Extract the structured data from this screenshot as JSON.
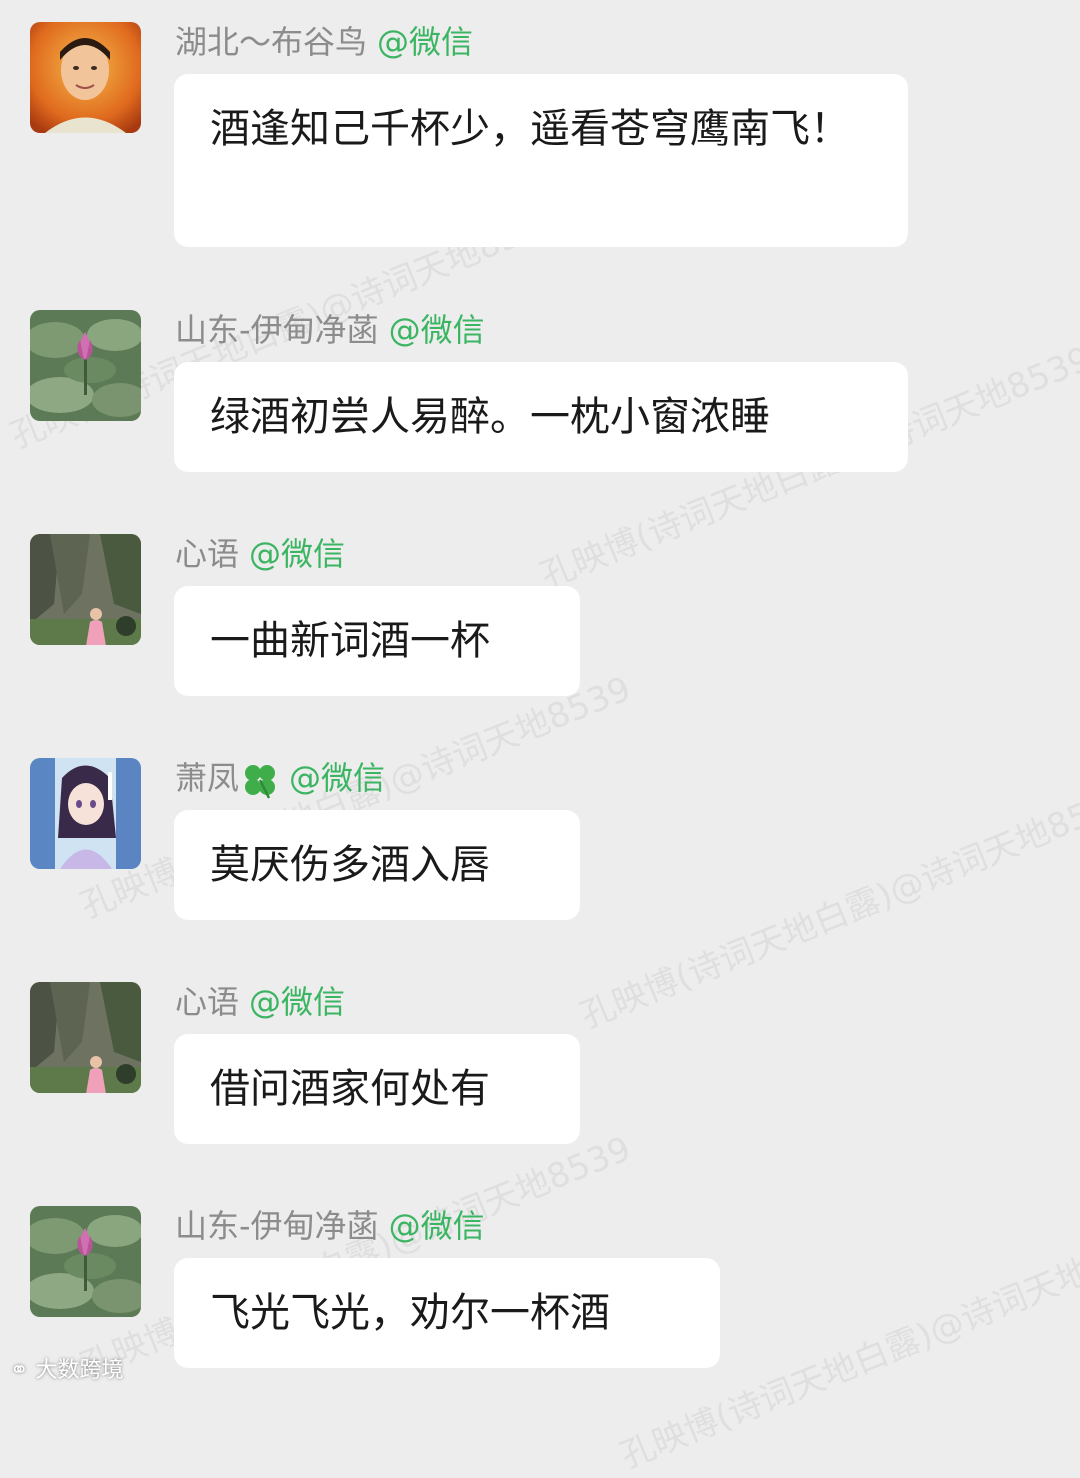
{
  "chat": {
    "messages": [
      {
        "sender": "湖北～布谷鸟",
        "tag": "@微信",
        "avatar": "man-portrait-avatar",
        "text": "酒逢知己千杯少，遥看苍穹鹰南飞！"
      },
      {
        "sender": "山东-伊甸净菡",
        "tag": "@微信",
        "avatar": "lotus-avatar",
        "text": "绿酒初尝人易醉。一枕小窗浓睡"
      },
      {
        "sender": "心语",
        "tag": "@微信",
        "avatar": "rock-landscape-avatar",
        "text": "一曲新词酒一杯"
      },
      {
        "sender": "萧凤",
        "emoji": "four-leaf-clover",
        "tag": "@微信",
        "avatar": "anime-girl-avatar",
        "text": "莫厌伤多酒入唇"
      },
      {
        "sender": "心语",
        "tag": "@微信",
        "avatar": "rock-landscape-avatar",
        "text": "借问酒家何处有"
      },
      {
        "sender": "山东-伊甸净菡",
        "tag": "@微信",
        "avatar": "lotus-avatar",
        "text": "飞光飞光，劝尔一杯酒"
      }
    ]
  },
  "watermark": {
    "line1": "孔映博(诗词天地白露)@诗词天地8539"
  },
  "footer": {
    "logo_text": "大数跨境"
  },
  "colors": {
    "background": "#ededed",
    "bubble": "#ffffff",
    "sender_name": "#8c8c8c",
    "wechat_tag": "#3cb563",
    "message_text": "#1a1a1a"
  }
}
